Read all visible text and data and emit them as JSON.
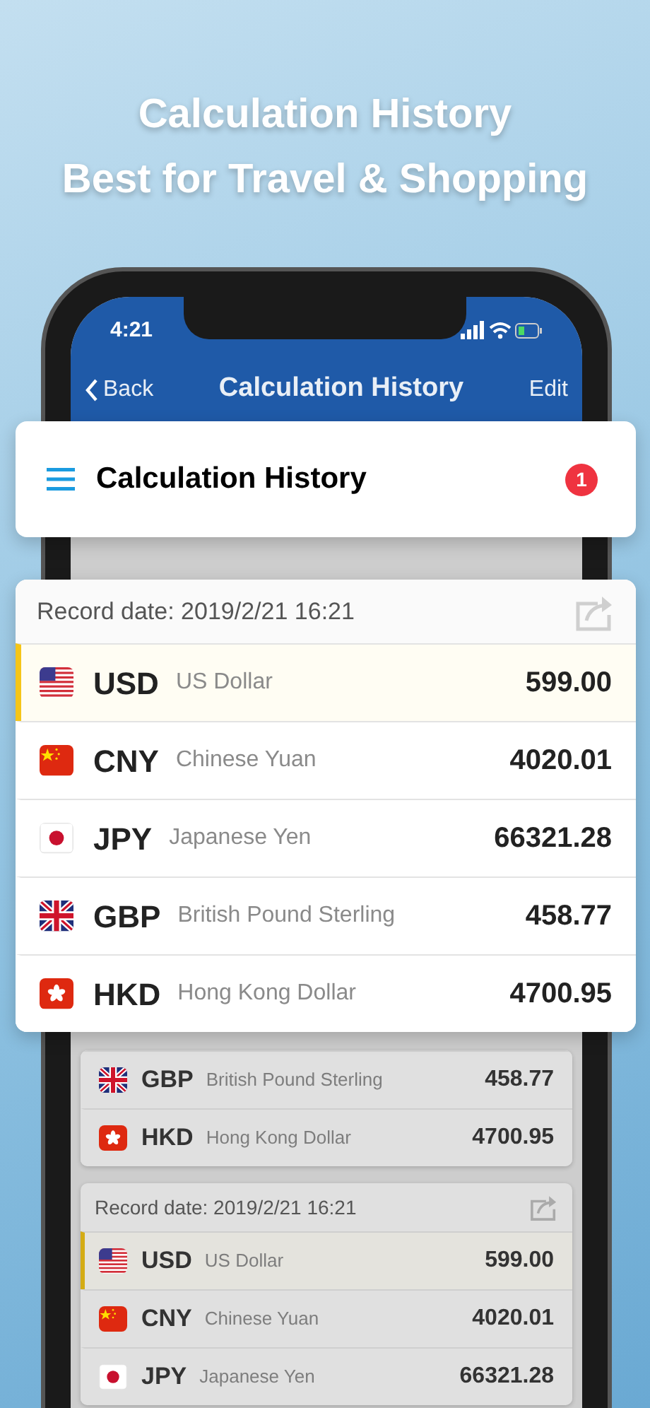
{
  "headline": [
    "Calculation History",
    "Best for Travel & Shopping"
  ],
  "status_bar": {
    "time": "4:21"
  },
  "nav_bar": {
    "back": "Back",
    "title": "Calculation History",
    "action": "Edit"
  },
  "header_card": {
    "title": "Calculation History",
    "badge": "1"
  },
  "focused_record": {
    "date": "Record date: 2019/2/21 16:21",
    "rows": [
      {
        "kind": "us",
        "code": "USD",
        "name": "US Dollar",
        "amount": "599.00",
        "selected": true
      },
      {
        "kind": "cn",
        "code": "CNY",
        "name": "Chinese Yuan",
        "amount": "4020.01",
        "selected": false
      },
      {
        "kind": "jp",
        "code": "JPY",
        "name": "Japanese Yen",
        "amount": "66321.28",
        "selected": false
      },
      {
        "kind": "gb",
        "code": "GBP",
        "name": "British Pound Sterling",
        "amount": "458.77",
        "selected": false
      },
      {
        "kind": "hk",
        "code": "HKD",
        "name": "Hong Kong Dollar",
        "amount": "4700.95",
        "selected": false
      }
    ]
  },
  "background_records": [
    {
      "rows": [
        {
          "kind": "gb",
          "code": "GBP",
          "name": "British Pound Sterling",
          "amount": "458.77",
          "selected": false
        },
        {
          "kind": "hk",
          "code": "HKD",
          "name": "Hong Kong Dollar",
          "amount": "4700.95",
          "selected": false
        }
      ]
    },
    {
      "date": "Record date: 2019/2/21 16:21",
      "rows": [
        {
          "kind": "us",
          "code": "USD",
          "name": "US Dollar",
          "amount": "599.00",
          "selected": true
        },
        {
          "kind": "cn",
          "code": "CNY",
          "name": "Chinese Yuan",
          "amount": "4020.01",
          "selected": false
        },
        {
          "kind": "jp",
          "code": "JPY",
          "name": "Japanese Yen",
          "amount": "66321.28",
          "selected": false
        }
      ]
    }
  ]
}
